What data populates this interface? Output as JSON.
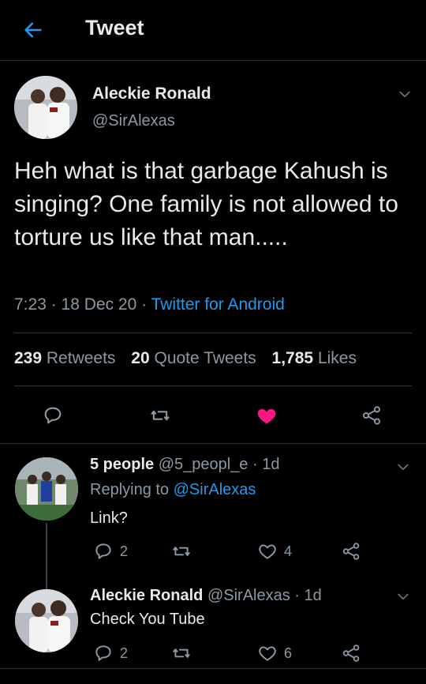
{
  "header": {
    "title": "Tweet",
    "back_icon": "arrow-left-icon",
    "accent": "#1d9bf0"
  },
  "tweet": {
    "author_name": "Aleckie Ronald",
    "author_handle": "@SirAlexas",
    "text": "Heh what is that garbage Kahush is singing? One family is not allowed to torture us like that man.....",
    "time": "7:23",
    "sep1": " · ",
    "date": "18 Dec 20",
    "sep2": " · ",
    "source": "Twitter for Android",
    "stats": {
      "retweets_count": "239",
      "retweets_label": "Retweets",
      "quote_count": "20",
      "quote_label": "Quote Tweets",
      "likes_count": "1,785",
      "likes_label": "Likes"
    },
    "like_color": "#f91880"
  },
  "replies": [
    {
      "name": "5 people",
      "handle": "@5_peopl_e",
      "sep": " · ",
      "age": "1d",
      "replying_prefix": "Replying to ",
      "replying_to": "@SirAlexas",
      "text": "Link?",
      "reply_count": "2",
      "retweet_count": "",
      "like_count": "4"
    },
    {
      "name": "Aleckie Ronald",
      "handle": "@SirAlexas",
      "sep": " · ",
      "age": "1d",
      "text": "Check You Tube",
      "reply_count": "2",
      "retweet_count": "",
      "like_count": "6"
    }
  ]
}
